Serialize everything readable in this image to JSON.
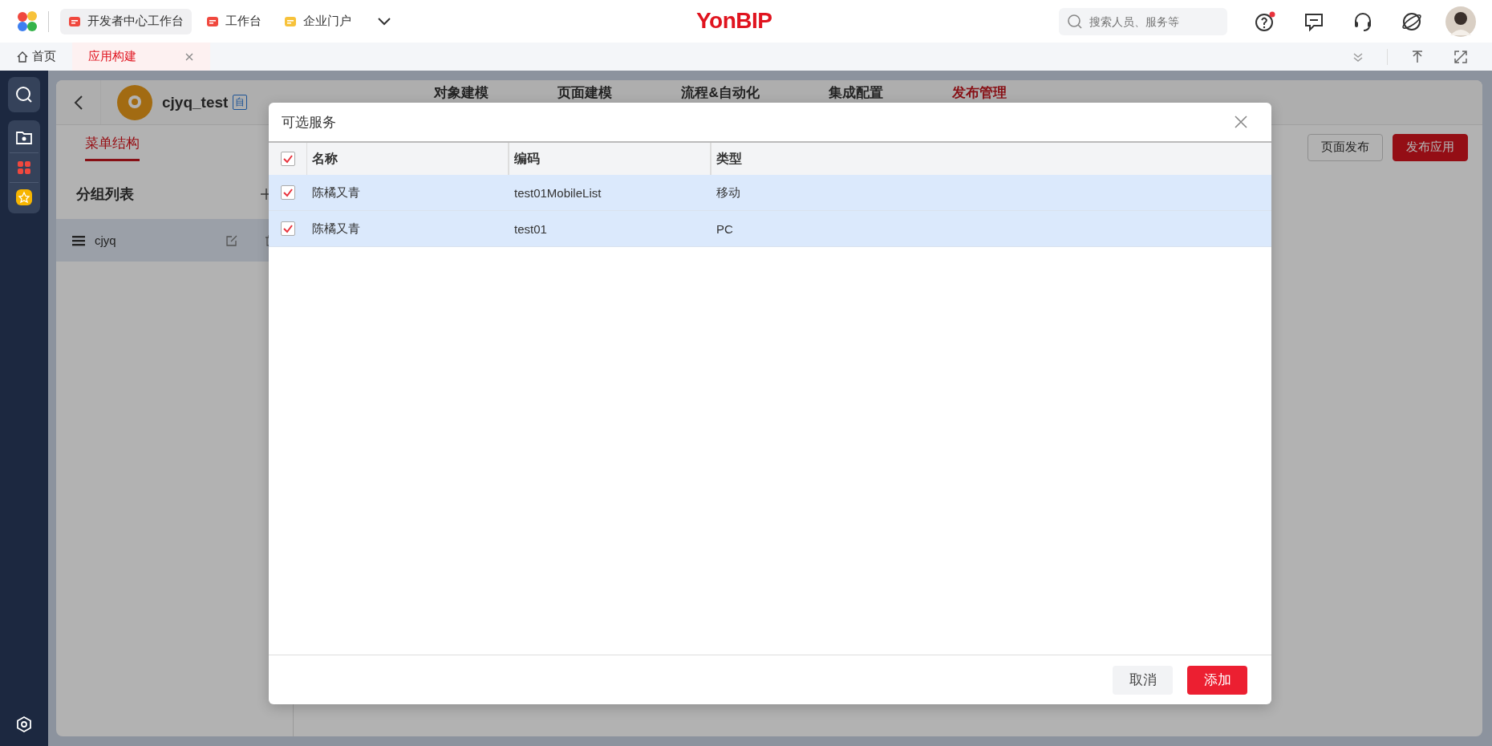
{
  "top_bar": {
    "logo": "YonBIP",
    "workspaces": [
      {
        "label": "开发者中心工作台",
        "selected": true,
        "color": "#f0483e"
      },
      {
        "label": "工作台",
        "selected": false,
        "color": "#f0483e"
      },
      {
        "label": "企业门户",
        "selected": false,
        "color": "#f7c23a"
      }
    ],
    "search": {
      "placeholder": "搜索人员、服务等"
    },
    "help_has_notification": true
  },
  "page_tabs": [
    {
      "label": "首页",
      "selected": false,
      "kind": "home"
    },
    {
      "label": "应用构建",
      "selected": true,
      "kind": "closable"
    }
  ],
  "app": {
    "name": "cjyq_test",
    "badge": "自",
    "nav": [
      {
        "label": "对象建模",
        "selected": false
      },
      {
        "label": "页面建模",
        "selected": false
      },
      {
        "label": "流程&自动化",
        "selected": false
      },
      {
        "label": "集成配置",
        "selected": false
      },
      {
        "label": "发布管理",
        "selected": true
      }
    ],
    "subtabs": [
      {
        "label": "菜单结构",
        "selected": true
      }
    ],
    "actions": [
      {
        "label": "页面发布",
        "kind": "secondary"
      },
      {
        "label": "发布应用",
        "kind": "primary"
      }
    ]
  },
  "group_list": {
    "title": "分组列表",
    "items": [
      {
        "name": "cjyq",
        "selected": true
      }
    ]
  },
  "dialog": {
    "title": "可选服务",
    "all_checked": true,
    "columns": [
      "名称",
      "编码",
      "类型"
    ],
    "rows": [
      {
        "name": "陈橘又青",
        "code": "test01MobileList",
        "type": "移动",
        "checked": true,
        "selected": true
      },
      {
        "name": "陈橘又青",
        "code": "test01",
        "type": "PC",
        "checked": true,
        "selected": true
      }
    ],
    "buttons": [
      {
        "label": "取消",
        "kind": "secondary"
      },
      {
        "label": "添加",
        "kind": "primary"
      }
    ]
  }
}
